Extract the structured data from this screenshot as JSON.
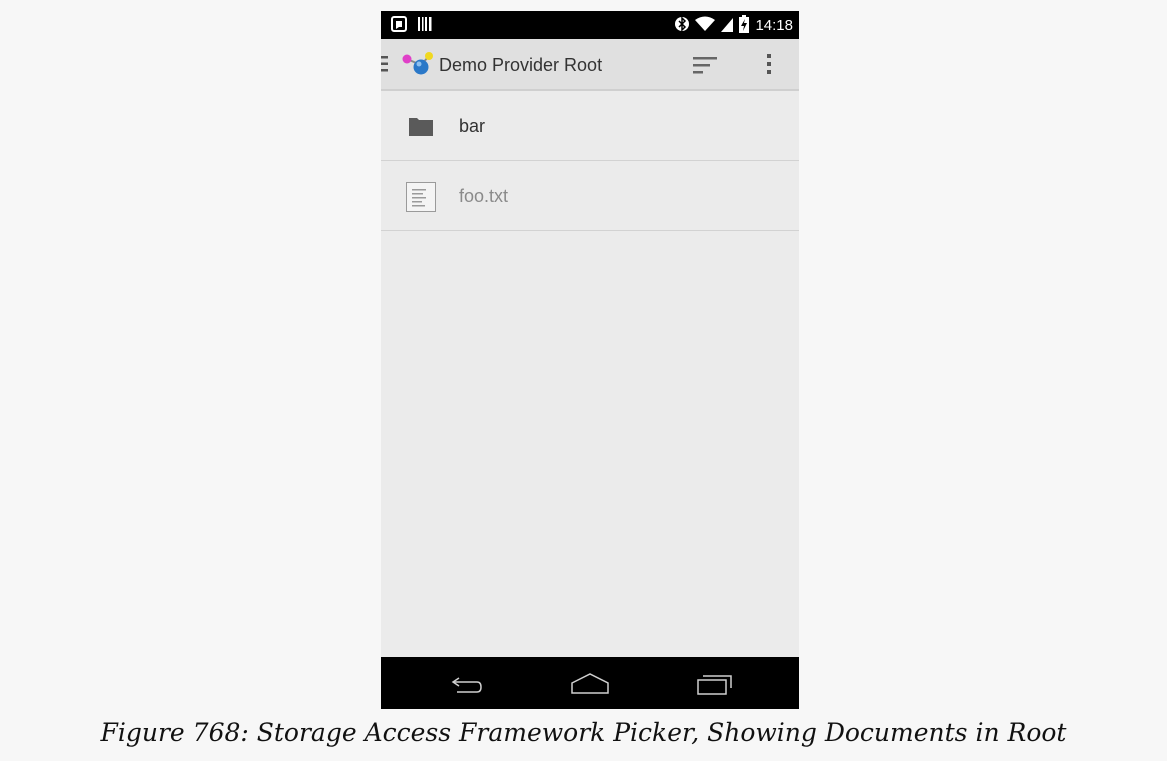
{
  "status_bar": {
    "time": "14:18",
    "icons": [
      "notification-icon",
      "barcode-icon",
      "bluetooth-icon",
      "wifi-icon",
      "signal-icon",
      "battery-charging-icon"
    ]
  },
  "action_bar": {
    "title": "Demo Provider Root",
    "icons": [
      "drawer-menu-icon",
      "app-logo-icon",
      "sort-icon",
      "overflow-menu-icon"
    ]
  },
  "documents": [
    {
      "name": "bar",
      "kind": "folder",
      "icon": "folder-icon"
    },
    {
      "name": "foo.txt",
      "kind": "file",
      "icon": "text-file-icon"
    }
  ],
  "nav_bar": {
    "icons": [
      "back-icon",
      "home-icon",
      "recents-icon"
    ]
  },
  "caption": "Figure 768: Storage Access Framework Picker, Showing Documents in Root"
}
